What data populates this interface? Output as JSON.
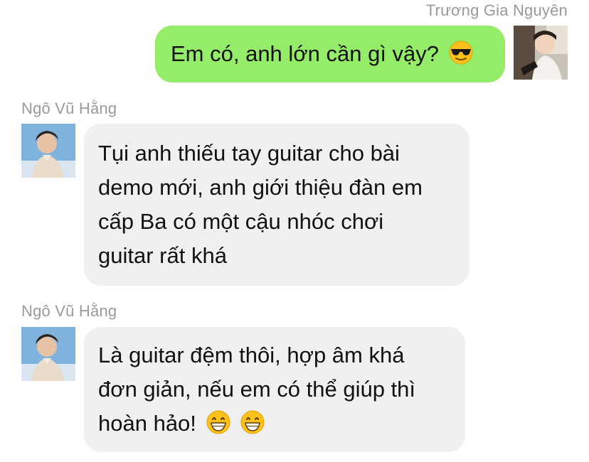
{
  "conversation": {
    "outgoing": {
      "sender": "Trương Gia Nguyên",
      "avatar_icon": "user-avatar-icon",
      "text": "Em có, anh lớn cần gì vậy?",
      "emoji": "smiling-face-with-sunglasses-icon"
    },
    "incoming": [
      {
        "sender": "Ngô Vũ Hằng",
        "avatar_icon": "user-avatar-icon",
        "lines": [
          "Tụi anh thiếu tay guitar cho bài",
          "demo mới, anh giới thiệu đàn em",
          "cấp Ba có một cậu nhóc chơi",
          "guitar rất khá"
        ]
      },
      {
        "sender": "Ngô Vũ Hằng",
        "avatar_icon": "user-avatar-icon",
        "lines": [
          "Là guitar đệm thôi, hợp âm khá",
          "đơn giản, nếu em có thể giúp thì",
          "hoàn hảo!"
        ],
        "emojis": [
          "grinning-face-icon",
          "grinning-face-icon"
        ]
      }
    ]
  },
  "colors": {
    "outgoing_bubble": "#95ec69",
    "incoming_bubble": "#f0f0f0",
    "name_text": "#9a9a9a",
    "message_text": "#111111"
  }
}
